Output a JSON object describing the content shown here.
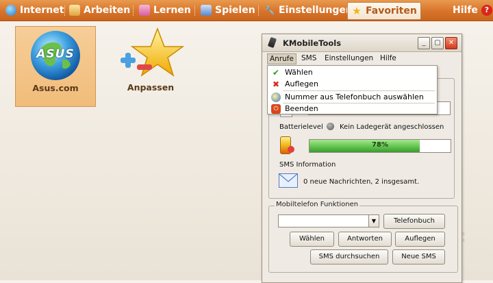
{
  "topbar": {
    "tabs": [
      {
        "label": "Internet",
        "icon": "globe-icon"
      },
      {
        "label": "Arbeiten",
        "icon": "briefcase-icon"
      },
      {
        "label": "Lernen",
        "icon": "book-icon"
      },
      {
        "label": "Spielen",
        "icon": "gamepad-icon"
      },
      {
        "label": "Einstellungen",
        "icon": "wrench-icon"
      },
      {
        "label": "Favoriten",
        "icon": "star-icon"
      }
    ],
    "help": "Hilfe"
  },
  "tiles": [
    {
      "label": "Asus.com",
      "logo": "ASUS"
    },
    {
      "label": "Anpassen"
    }
  ],
  "window": {
    "title": "KMobileTools",
    "menu": [
      "Anrufe",
      "SMS",
      "Einstellungen",
      "Hilfe"
    ],
    "dropdown": [
      {
        "label": "Wählen",
        "icon": "check-icon"
      },
      {
        "label": "Auflegen",
        "icon": "x-icon"
      },
      {
        "label": "Nummer aus Telefonbuch auswählen",
        "icon": "phonebook-icon"
      },
      {
        "label": "Beenden",
        "icon": "quit-icon"
      }
    ],
    "battery_label": "Batterielevel",
    "charger_status": "Kein Ladegerät angeschlossen",
    "battery_percent": "78%",
    "battery_fraction": 0.78,
    "sms_info_label": "SMS Information",
    "sms_status": "0 neue Nachrichten, 2 insgesamt.",
    "functions_group": "Mobiltelefon Funktionen",
    "buttons": {
      "phonebook": "Telefonbuch",
      "dial": "Wählen",
      "answer": "Antworten",
      "hangup": "Auflegen",
      "search_sms": "SMS durchsuchen",
      "new_sms": "Neue SMS"
    }
  }
}
